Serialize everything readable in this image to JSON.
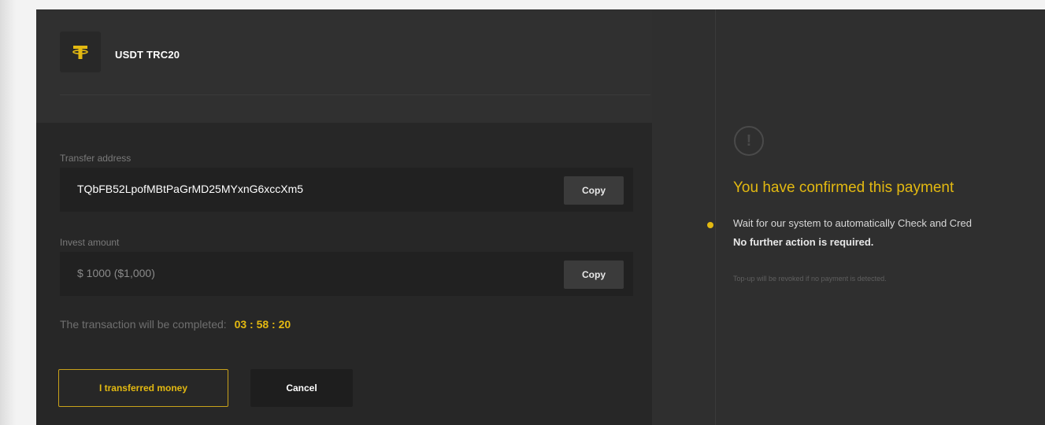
{
  "coin": {
    "name": "USDT TRC20",
    "icon": "tether-icon",
    "icon_color": "#e3b911"
  },
  "transfer": {
    "label": "Transfer address",
    "address": "TQbFB52LpofMBtPaGrMD25MYxnG6xccXm5",
    "copy_label": "Copy"
  },
  "invest": {
    "label": "Invest amount",
    "amount": "$ 1000 ($1,000)",
    "copy_label": "Copy"
  },
  "timer": {
    "text": "The transaction will be completed:",
    "time": "03 : 58 : 20"
  },
  "actions": {
    "transferred_label": "I transferred money",
    "cancel_label": "Cancel"
  },
  "status": {
    "icon": "exclamation-circle-icon",
    "title": "You have confirmed this payment",
    "wait_text": "Wait for our system to automatically Check and Cred",
    "no_action": "No further action is required.",
    "note": "Top-up will be revoked if no payment is detected."
  },
  "colors": {
    "accent": "#e3b911",
    "panel_bg": "#2e2e2e",
    "field_bg": "#212121"
  }
}
